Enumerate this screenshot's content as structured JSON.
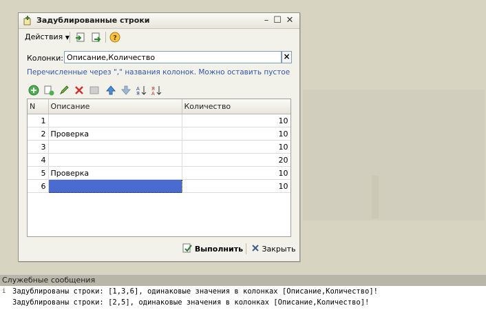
{
  "window": {
    "title": "Задублированные строки"
  },
  "toolbar": {
    "actions_label": "Действия"
  },
  "columns_field": {
    "label": "Колонки:",
    "value": "Описание,Количество",
    "hint": "Перечисленные через \",\" названия колонок. Можно оставить пустое"
  },
  "grid": {
    "headers": [
      "N",
      "Описание",
      "Количество"
    ],
    "rows": [
      {
        "n": "1",
        "desc": "",
        "qty": "10"
      },
      {
        "n": "2",
        "desc": "Проверка",
        "qty": "10"
      },
      {
        "n": "3",
        "desc": "",
        "qty": "10"
      },
      {
        "n": "4",
        "desc": "",
        "qty": "20"
      },
      {
        "n": "5",
        "desc": "Проверка",
        "qty": "10"
      },
      {
        "n": "6",
        "desc": "",
        "qty": "10"
      }
    ],
    "selected_row": 6
  },
  "buttons": {
    "run": "Выполнить",
    "close": "Закрыть"
  },
  "messages": {
    "header": "Служебные сообщения",
    "lines": [
      "Задублированы строки: [1,3,6], одинаковые значения в колонках [Описание,Количество]!",
      "Задублированы строки: [2,5], одинаковые значения в колонках [Описание,Количество]!"
    ]
  },
  "colors": {
    "selection": "#4a6bd0",
    "hint": "#3355aa"
  }
}
